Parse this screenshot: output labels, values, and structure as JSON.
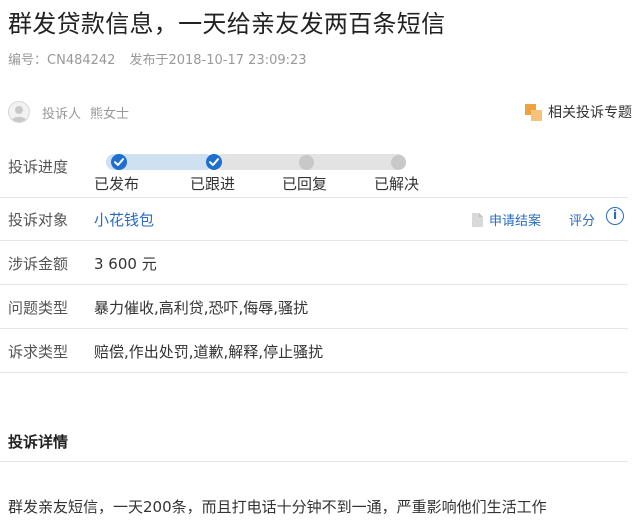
{
  "header": {
    "title": "群发贷款信息，一天给亲友发两百条短信",
    "id_label": "编号：",
    "id_value": "CN484242",
    "published_label": "发布于",
    "published_value": "2018-10-17 23:09:23"
  },
  "author": {
    "label": "投诉人",
    "name": "熊女士",
    "related_topic": "相关投诉专题"
  },
  "progress": {
    "label": "投诉进度",
    "steps": [
      {
        "label": "已发布",
        "done": true
      },
      {
        "label": "已跟进",
        "done": true
      },
      {
        "label": "已回复",
        "done": false
      },
      {
        "label": "已解决",
        "done": false
      }
    ]
  },
  "target": {
    "label": "投诉对象",
    "value": "小花钱包",
    "settle": "申请结案",
    "rate": "评分",
    "info_glyph": "i"
  },
  "amount": {
    "label": "涉诉金额",
    "value": "3 600 元"
  },
  "issue_type": {
    "label": "问题类型",
    "value": "暴力催收,高利贷,恐吓,侮辱,骚扰"
  },
  "demand_type": {
    "label": "诉求类型",
    "value": "赔偿,作出处罚,道歉,解释,停止骚扰"
  },
  "detail": {
    "heading": "投诉详情",
    "text": "群发亲友短信，一天200条，而且打电话十分钟不到一通，严重影响他们生活工作"
  },
  "colors": {
    "accent": "#2a6bbf",
    "step_done": "#1f6fd1",
    "step_pending": "#c8c8c8",
    "topic_icon": "#f0a33c"
  },
  "icons": {
    "avatar": "user-avatar-icon",
    "topic": "topic-squares-icon",
    "settle": "document-icon",
    "info": "info-icon",
    "step_done": "check-icon"
  }
}
